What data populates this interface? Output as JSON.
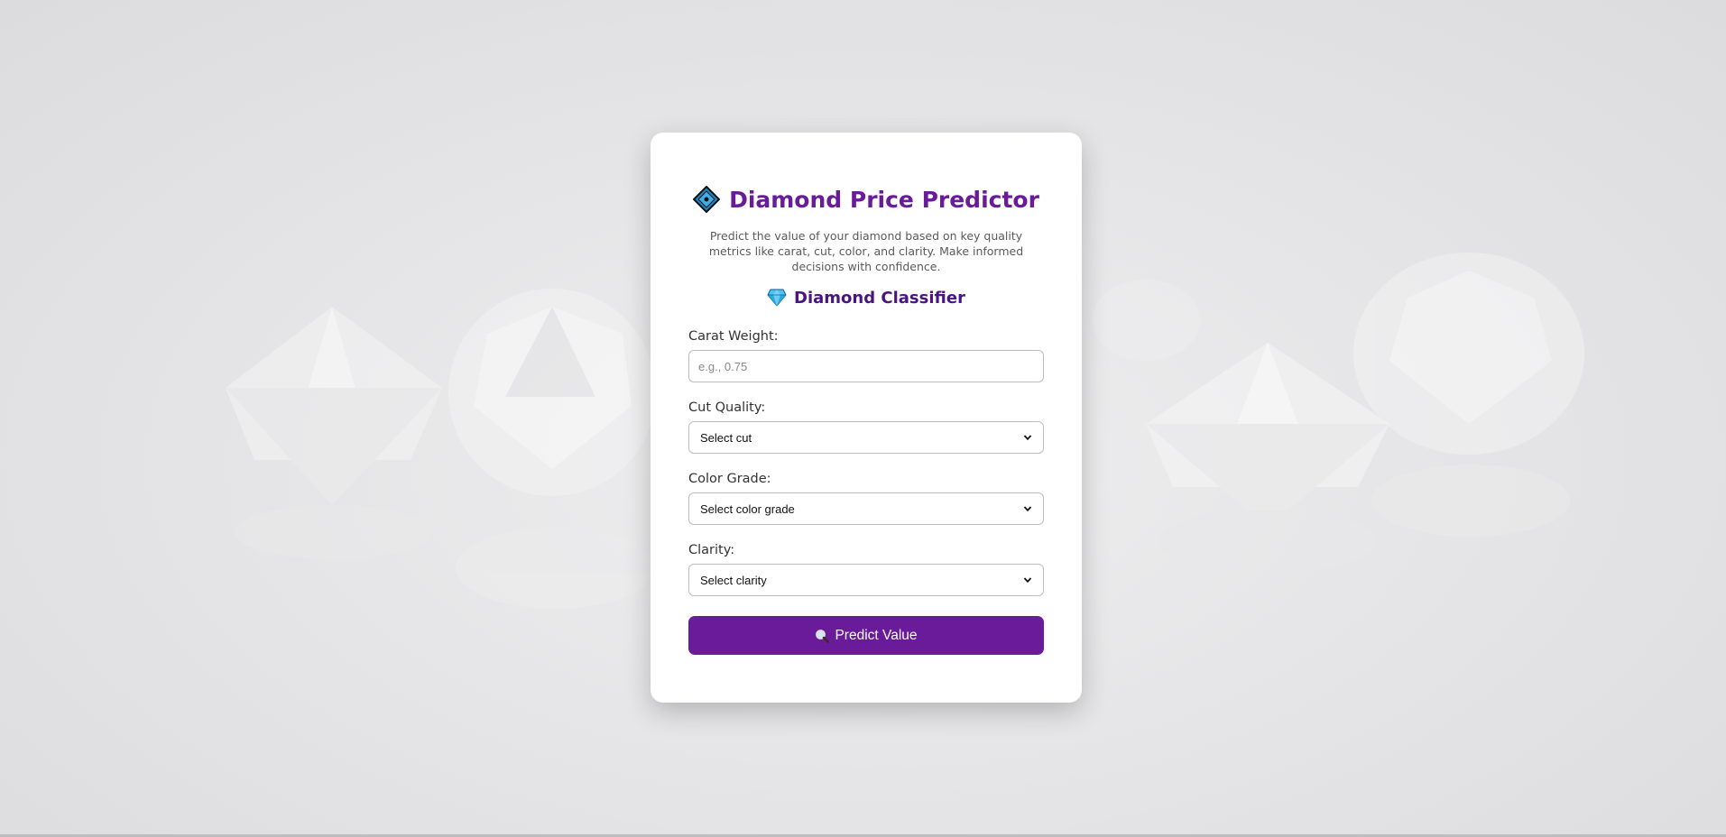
{
  "header": {
    "title": "Diamond Price Predictor",
    "title_icon": "diamond-shape-icon",
    "description": "Predict the value of your diamond based on key quality metrics like carat, cut, color, and clarity. Make informed decisions with confidence.",
    "subtitle": "Diamond Classifier",
    "subtitle_icon": "gem-icon"
  },
  "form": {
    "carat": {
      "label": "Carat Weight:",
      "placeholder": "e.g., 0.75",
      "value": ""
    },
    "cut": {
      "label": "Cut Quality:",
      "selected": "Select cut"
    },
    "color": {
      "label": "Color Grade:",
      "selected": "Select color grade"
    },
    "clarity": {
      "label": "Clarity:",
      "selected": "Select clarity"
    },
    "submit": {
      "label": "Predict Value",
      "icon": "magnifier-icon"
    }
  },
  "colors": {
    "accent": "#6a1b9a",
    "subtitle": "#4a1580",
    "background": "#e3e3e5",
    "card": "#ffffff"
  }
}
